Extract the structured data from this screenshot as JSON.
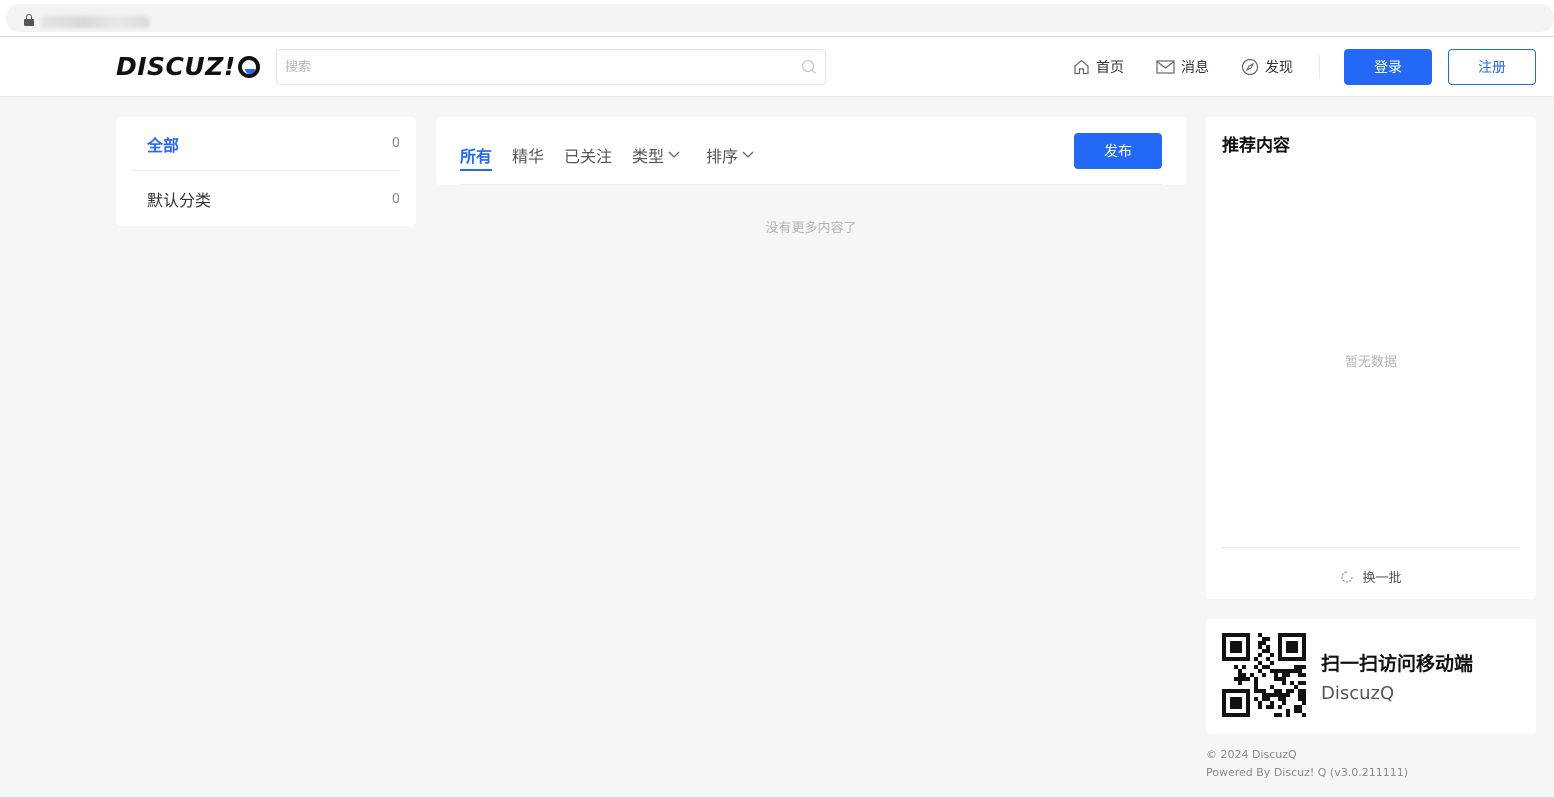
{
  "header": {
    "logo_text": "DISCUZ!",
    "search_placeholder": "搜索",
    "nav": {
      "home": "首页",
      "messages": "消息",
      "discover": "发现"
    },
    "login_label": "登录",
    "register_label": "注册"
  },
  "categories": [
    {
      "label": "全部",
      "count": "0"
    },
    {
      "label": "默认分类",
      "count": "0"
    }
  ],
  "content": {
    "tabs": {
      "all": "所有",
      "essence": "精华",
      "following": "已关注",
      "type": "类型",
      "sort": "排序"
    },
    "publish_label": "发布",
    "empty_text": "没有更多内容了"
  },
  "recommend": {
    "title": "推荐内容",
    "empty_text": "暂无数据",
    "refresh_label": "换一批"
  },
  "qr": {
    "title": "扫一扫访问移动端",
    "subtitle": "DiscuzQ"
  },
  "footer": {
    "copyright": "© 2024 DiscuzQ",
    "powered": "Powered By Discuz! Q (v3.0.211111)"
  },
  "colors": {
    "accent": "#2469f6",
    "page_bg": "#f5f6f8"
  }
}
